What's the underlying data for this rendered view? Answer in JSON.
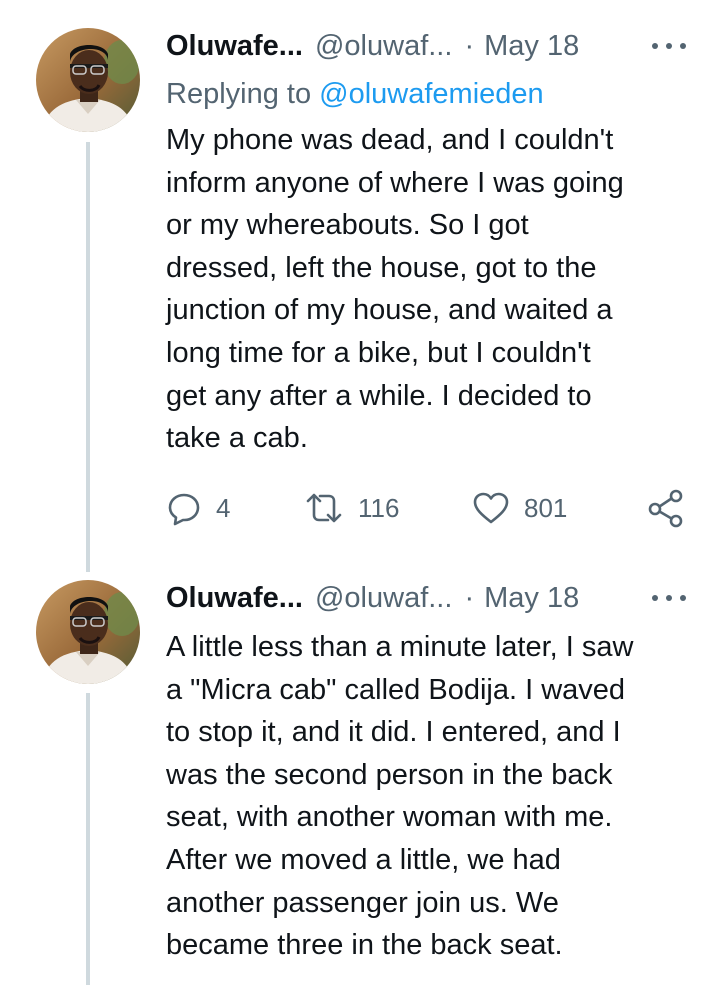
{
  "tweets": [
    {
      "author_name": "Oluwafe...",
      "handle": "@oluwaf...",
      "separator": "·",
      "date": "May 18",
      "reply_prefix": "Replying to",
      "reply_to": "@oluwafemieden",
      "lines": [
        "My phone was dead, and I couldn't",
        "inform anyone of where I was going",
        "or my whereabouts. So I got",
        "dressed, left the house, got to the",
        "junction of my house, and waited a",
        "long time for a bike, but I couldn't",
        "get any after a while. I decided to",
        "take a cab."
      ],
      "replies": "4",
      "retweets": "116",
      "likes": "801"
    },
    {
      "author_name": "Oluwafe...",
      "handle": "@oluwaf...",
      "separator": "·",
      "date": "May 18",
      "lines": [
        "A little less than a minute later, I saw",
        "a \"Micra cab\" called Bodija. I waved",
        "to stop it, and it did. I entered, and I",
        "was the second person in the back",
        "seat, with another woman with me.",
        "After we moved a little, we had",
        "another passenger join us. We",
        "became three in the back seat."
      ]
    }
  ],
  "icons": {
    "reply": "speech-bubble-icon",
    "retweet": "retweet-arrows-icon",
    "like": "heart-icon",
    "share": "share-nodes-icon",
    "more": "three-dots-icon"
  },
  "colors": {
    "text": "#0f1419",
    "secondary": "#536471",
    "link": "#1d9bf0",
    "thread_line": "#cfd9de"
  }
}
